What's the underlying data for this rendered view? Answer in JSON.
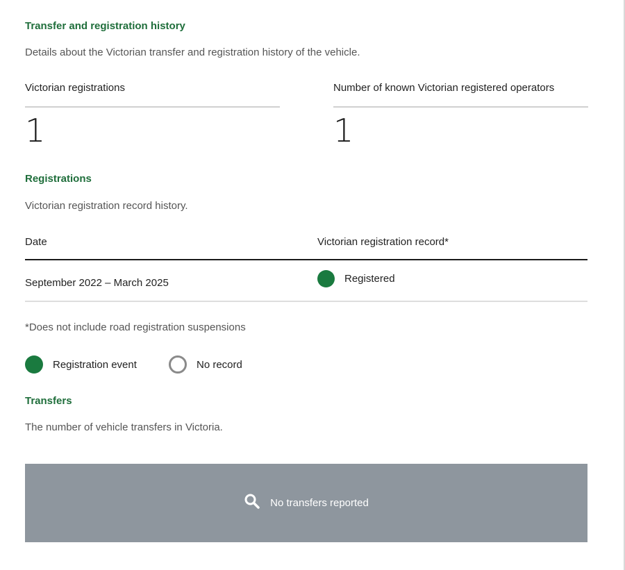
{
  "transfer_history": {
    "heading": "Transfer and registration history",
    "description": "Details about the Victorian transfer and registration history of the vehicle."
  },
  "stats": {
    "registrations": {
      "label": "Victorian registrations",
      "value": "1"
    },
    "operators": {
      "label": "Number of known Victorian registered operators",
      "value": "1"
    }
  },
  "registrations": {
    "heading": "Registrations",
    "description": "Victorian registration record history.",
    "table": {
      "columns": [
        "Date",
        "Victorian registration record*"
      ],
      "rows": [
        {
          "date": "September 2022 – March 2025",
          "status": "Registered"
        }
      ]
    },
    "footnote": "*Does not include road registration suspensions",
    "legend": {
      "event_label": "Registration event",
      "no_record_label": "No record"
    }
  },
  "transfers": {
    "heading": "Transfers",
    "description": "The number of vehicle transfers in Victoria.",
    "empty_message": "No transfers reported",
    "empty_icon": "search-icon"
  },
  "colors": {
    "accent_green": "#1f6e3b",
    "registered_dot": "#1a7a3f",
    "empty_panel_bg": "#8e969e"
  }
}
